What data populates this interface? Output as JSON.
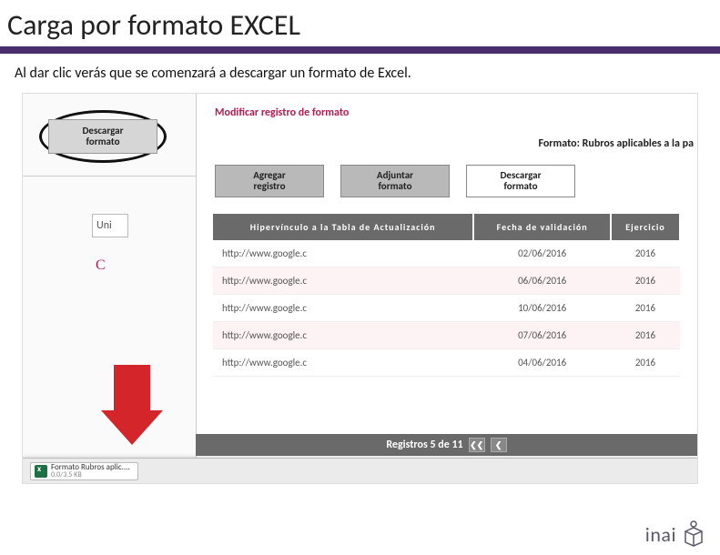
{
  "slide": {
    "title": "Carga por formato EXCEL",
    "subtitle": "Al dar clic verás que se comenzará a descargar un formato de Excel."
  },
  "left": {
    "descargar_l1": "Descargar",
    "descargar_l2": "formato",
    "uni": "Uni",
    "c": "C"
  },
  "panel": {
    "modificar": "Modificar registro de formato",
    "formato_line": "Formato: Rubros aplicables a la pa",
    "buttons": {
      "agregar_l1": "Agregar",
      "agregar_l2": "registro",
      "adjuntar_l1": "Adjuntar",
      "adjuntar_l2": "formato",
      "descargar_l1": "Descargar",
      "descargar_l2": "formato"
    }
  },
  "table": {
    "headers": {
      "h1": "Hipervínculo a la Tabla de Actualización",
      "h2": "Fecha de validación",
      "h3": "Ejercicio"
    },
    "rows": [
      {
        "link": "http://www.google.c",
        "fecha": "02/06/2016",
        "ej": "2016"
      },
      {
        "link": "http://www.google.c",
        "fecha": "06/06/2016",
        "ej": "2016"
      },
      {
        "link": "http://www.google.c",
        "fecha": "10/06/2016",
        "ej": "2016"
      },
      {
        "link": "http://www.google.c",
        "fecha": "07/06/2016",
        "ej": "2016"
      },
      {
        "link": "http://www.google.c",
        "fecha": "04/06/2016",
        "ej": "2016"
      }
    ]
  },
  "footer": {
    "registros": "Registros 5 de 11",
    "prev": "❮❮",
    "prev1": "❮"
  },
  "download": {
    "filename": "Formato Rubros aplic....",
    "filesize": "0.0/3.5 KB"
  },
  "logo": {
    "text": "inai"
  }
}
